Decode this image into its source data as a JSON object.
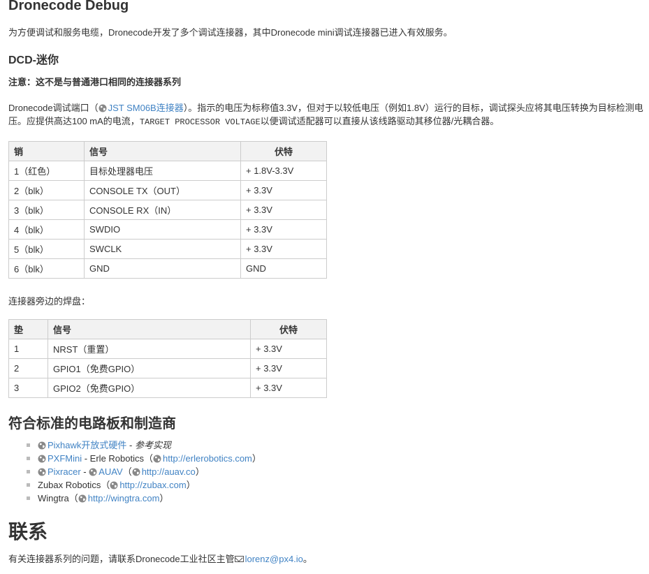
{
  "title": "Dronecode Debug",
  "intro": "为方便调试和服务电缆，Dronecode开发了多个调试连接器，其中Dronecode mini调试连接器已进入有效服务。",
  "section_dcd": {
    "heading": "DCD-迷你",
    "note": "注意：这不是与普通港口相同的连接器系列",
    "para_prefix": "Dronecode调试端口（",
    "para_link": "JST SM06B连接器",
    "para_mid": "）。指示的电压为标称值3.3V，但对于以较低电压（例如1.8V）运行的目标，调试探头应将其电压转换为目标检测电压。应提供高达100 mA的电流，",
    "para_code": "TARGET PROCESSOR VOLTAGE",
    "para_suffix": "以便调试适配器可以直接从该线路驱动其移位器/光耦合器。"
  },
  "pins_table": {
    "headers": [
      "销",
      "信号",
      "伏特"
    ],
    "rows": [
      [
        "1（红色）",
        "目标处理器电压",
        "+ 1.8V-3.3V"
      ],
      [
        "2（blk）",
        "CONSOLE TX（OUT）",
        "+ 3.3V"
      ],
      [
        "3（blk）",
        "CONSOLE RX（IN）",
        "+ 3.3V"
      ],
      [
        "4（blk）",
        "SWDIO",
        "+ 3.3V"
      ],
      [
        "5（blk）",
        "SWCLK",
        "+ 3.3V"
      ],
      [
        "6（blk）",
        "GND",
        "GND"
      ]
    ]
  },
  "pads_label": "连接器旁边的焊盘：",
  "pads_table": {
    "headers": [
      "垫",
      "信号",
      "伏特"
    ],
    "rows": [
      [
        "1",
        "NRST（重置）",
        "+ 3.3V"
      ],
      [
        "2",
        "GPIO1（免费GPIO）",
        "+ 3.3V"
      ],
      [
        "3",
        "GPIO2（免费GPIO）",
        "+ 3.3V"
      ]
    ]
  },
  "manufacturers": {
    "heading": "符合标准的电路板和制造商",
    "items": [
      {
        "link1": "Pixhawk开放式硬件",
        "sep1": " - ",
        "em": "参考实现"
      },
      {
        "link1": "PXFMini",
        "sep1": " - Erle Robotics（",
        "link2": "http://erlerobotics.com",
        "end": "）"
      },
      {
        "link1": "Pixracer",
        "sep1": " - ",
        "link2": "AUAV",
        "mid": "（",
        "link3": "http://auav.co",
        "end": "）"
      },
      {
        "text": "Zubax Robotics（",
        "link2": "http://zubax.com",
        "end": "）"
      },
      {
        "text": "Wingtra（",
        "link2": "http://wingtra.com",
        "end": "）"
      }
    ]
  },
  "contact": {
    "heading": "联系",
    "text": "有关连接器系列的问题，请联系Dronecode工业社区主管",
    "email": "lorenz@px4.io",
    "end": "。"
  },
  "colors": {
    "link": "#4183c4",
    "text": "#333333",
    "table_header_bg": "#f2f2f2",
    "border": "#cccccc"
  }
}
